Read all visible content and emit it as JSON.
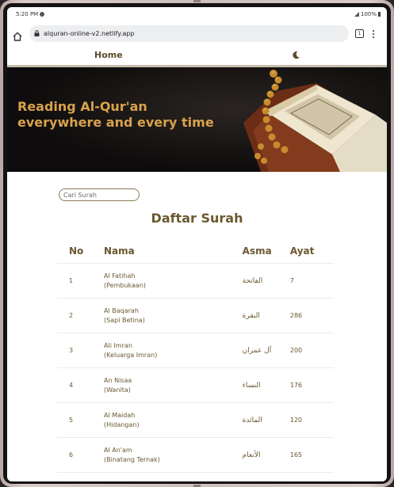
{
  "status": {
    "time": "5:20 PM",
    "battery": "100%"
  },
  "browser": {
    "url": "alquran-online-v2.netlify.app",
    "tab_count": "1"
  },
  "nav": {
    "home_label": "Home"
  },
  "hero": {
    "title_line1": "Reading Al-Qur'an",
    "title_line2": "everywhere and every time"
  },
  "search": {
    "placeholder": "Cari Surah"
  },
  "list": {
    "heading": "Daftar Surah",
    "headers": {
      "no": "No",
      "nama": "Nama",
      "asma": "Asma",
      "ayat": "Ayat"
    },
    "rows": [
      {
        "no": "1",
        "nama": "Al Fatihah",
        "arti": "(Pembukaan)",
        "asma": "الفاتحة",
        "ayat": "7"
      },
      {
        "no": "2",
        "nama": "Al Baqarah",
        "arti": "(Sapi Betina)",
        "asma": "البقرة",
        "ayat": "286"
      },
      {
        "no": "3",
        "nama": "Ali Imran",
        "arti": "(Keluarga Imran)",
        "asma": "آل عمران",
        "ayat": "200"
      },
      {
        "no": "4",
        "nama": "An Nisaa",
        "arti": "(Wanita)",
        "asma": "النساء",
        "ayat": "176"
      },
      {
        "no": "5",
        "nama": "Al Maidah",
        "arti": "(Hidangan)",
        "asma": "المائدة",
        "ayat": "120"
      },
      {
        "no": "6",
        "nama": "Al An'am",
        "arti": "(Binatang Ternak)",
        "asma": "الأنعام",
        "ayat": "165"
      }
    ]
  },
  "colors": {
    "accent": "#6b5830",
    "hero_text": "#d9a24c",
    "hero_bg": "#0d0b0b"
  }
}
